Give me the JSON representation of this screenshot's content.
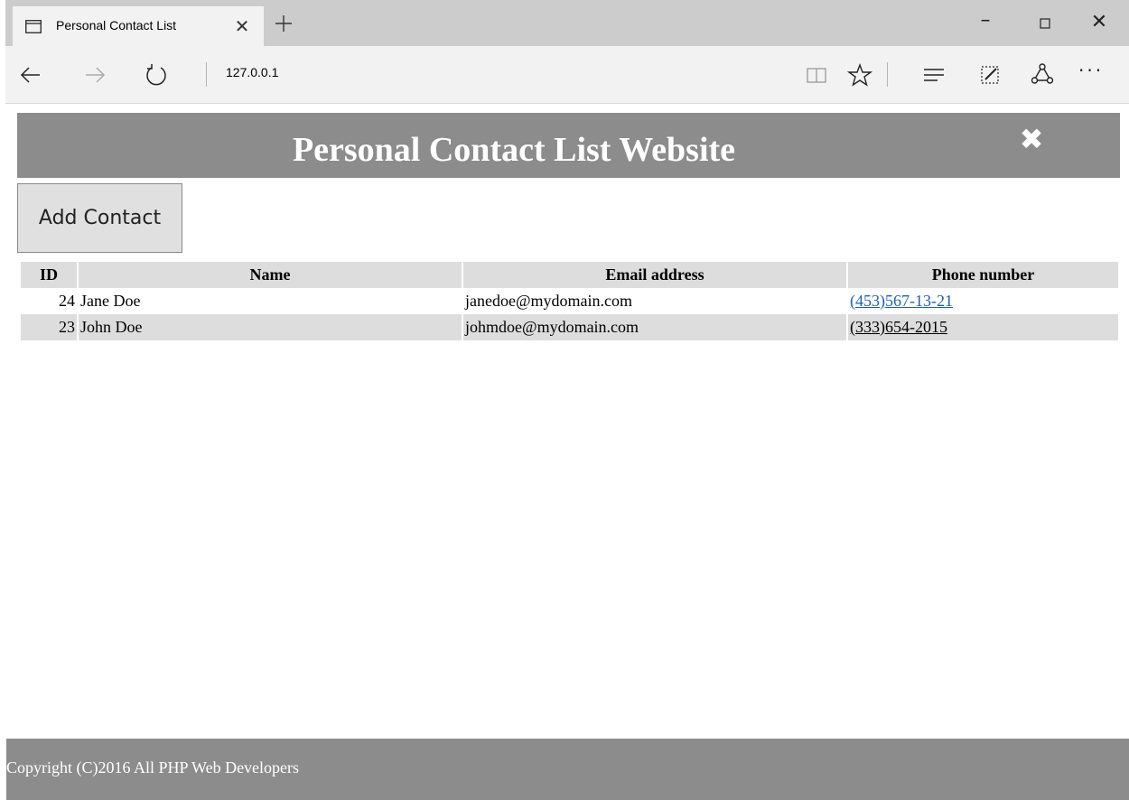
{
  "browser": {
    "tab_title": "Personal Contact List",
    "address": "127.0.0.1",
    "window_controls": {
      "minimize": "–",
      "maximize": "□",
      "close": "✕"
    },
    "tab_close": "✕",
    "more": "···",
    "icons": [
      "tab-page-icon",
      "new-tab-icon",
      "back-arrow-icon",
      "forward-arrow-icon",
      "refresh-icon",
      "reading-view-icon",
      "favorite-star-icon",
      "hub-icon",
      "web-note-icon",
      "share-icon",
      "more-icon"
    ]
  },
  "page": {
    "header_title": "Personal Contact List Website",
    "close_icon": "✖",
    "add_button_label": "Add Contact",
    "table": {
      "headers": {
        "id": "ID",
        "name": "Name",
        "email": "Email address",
        "phone": "Phone number"
      },
      "rows": [
        {
          "id": "24",
          "name": "Jane Doe",
          "email": "janedoe@mydomain.com",
          "phone": "(453)567-13-21"
        },
        {
          "id": "23",
          "name": "John Doe",
          "email": "johmdoe@mydomain.com",
          "phone": "(333)654-2015"
        }
      ]
    },
    "footer_text": "Copyright (C)2016 All PHP Web Developers"
  },
  "colors": {
    "header_bg": "#8c8c8c",
    "row_shade": "#dddddd",
    "link_visited_blue": "#1e5fb4"
  }
}
